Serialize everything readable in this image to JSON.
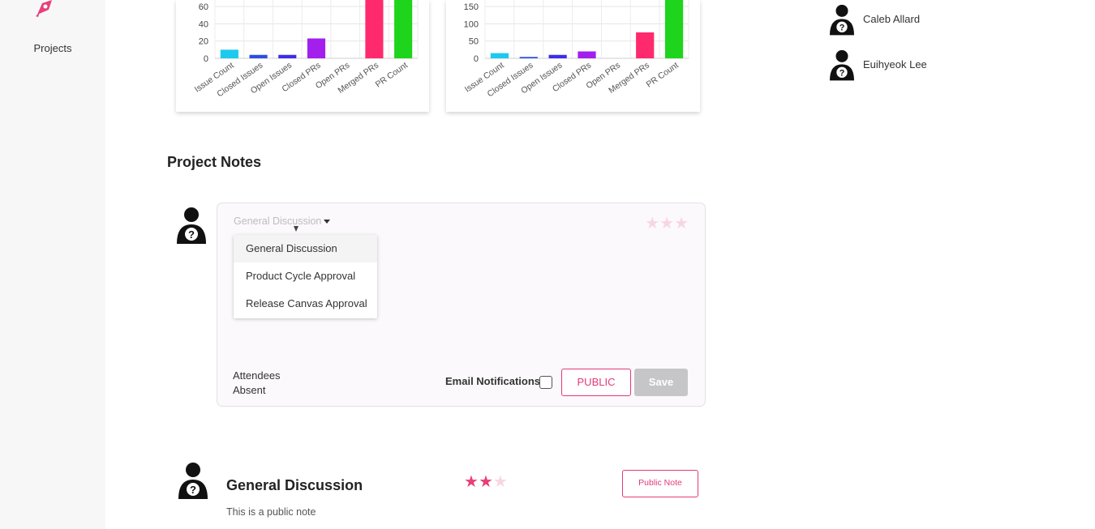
{
  "sidebar": {
    "projects_label": "Projects"
  },
  "colors": {
    "accent": "#e23a79",
    "save_disabled": "#c6c6c8"
  },
  "chart_data": [
    {
      "type": "bar",
      "categories": [
        "Issue Count",
        "Closed Issues",
        "Open Issues",
        "Closed PRs",
        "Open PRs",
        "Merged PRs",
        "PR Count"
      ],
      "values": [
        10,
        4,
        4,
        23,
        0,
        80,
        80
      ],
      "colors": [
        "#1ec9ee",
        "#2c4ee0",
        "#3d2ee6",
        "#a21fee",
        "#ff8e3c",
        "#ff2a6d",
        "#1fd41c"
      ],
      "yticks": [
        0,
        20,
        40,
        60
      ],
      "ylim": [
        0,
        80
      ]
    },
    {
      "type": "bar",
      "categories": [
        "Issue Count",
        "Closed Issues",
        "Open Issues",
        "Closed PRs",
        "Open PRs",
        "Merged PRs",
        "PR Count"
      ],
      "values": [
        15,
        4,
        10,
        20,
        0,
        75,
        200
      ],
      "colors": [
        "#1ec9ee",
        "#2c4ee0",
        "#3d2ee6",
        "#a21fee",
        "#ff8e3c",
        "#ff2a6d",
        "#1fd41c"
      ],
      "yticks": [
        0,
        50,
        100,
        150
      ],
      "ylim": [
        0,
        200
      ]
    }
  ],
  "members": [
    {
      "name": "Caleb Allard",
      "icon": "user-unknown-icon"
    },
    {
      "name": "Euihyeok Lee",
      "icon": "user-unknown-icon"
    }
  ],
  "notes_section": {
    "title": "Project Notes"
  },
  "editor": {
    "type_value": "General Discussion",
    "stars_total": 3,
    "stars_selected": 0,
    "dropdown_options": [
      "General Discussion",
      "Product Cycle Approval",
      "Release Canvas Approval"
    ],
    "attendees_label": "Attendees",
    "absent_label": "Absent",
    "email_label": "Email Notifications",
    "email_checked": false,
    "public_label": "PUBLIC",
    "save_label": "Save"
  },
  "note": {
    "title": "General Discussion",
    "body": "This is a public note",
    "rating": 2,
    "rating_max": 3,
    "badge_label": "Public Note"
  }
}
